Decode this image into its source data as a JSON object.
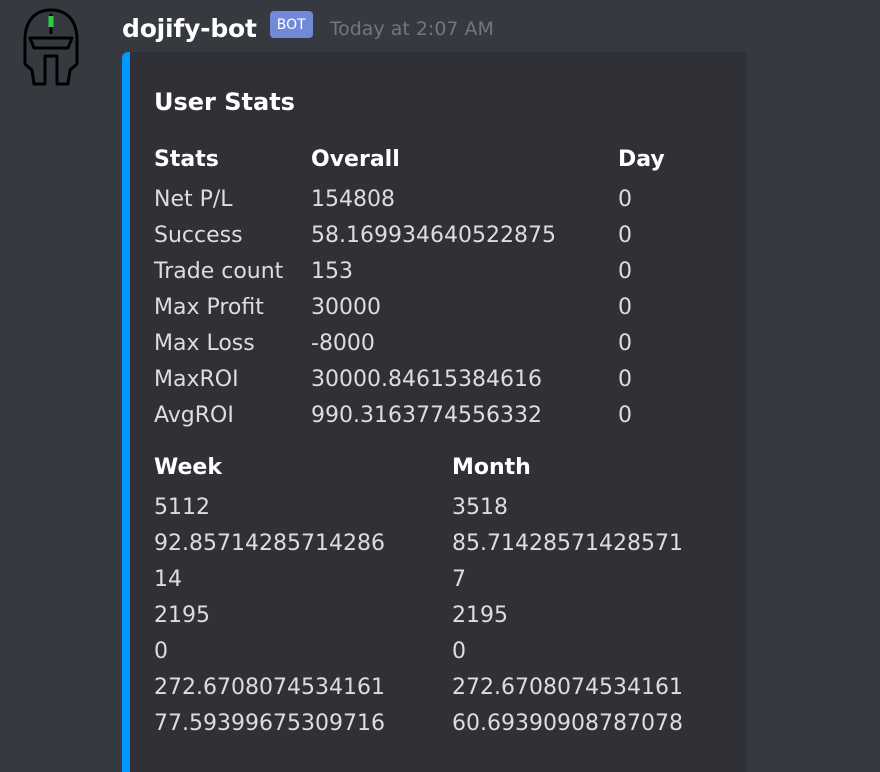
{
  "author": {
    "name": "dojify-bot",
    "tag": "BOT",
    "timestamp": "Today at 2:07 AM",
    "avatar_icon": "spartan-helmet-icon"
  },
  "colors": {
    "background": "#36393f",
    "embed_background": "#2f3136",
    "embed_accent": "#0099ff",
    "bot_tag": "#7289da",
    "timestamp": "#72767d",
    "helmet_eye": "#2ecc40"
  },
  "embed": {
    "title": "User Stats",
    "fields": [
      {
        "name": "Stats",
        "values": [
          "Net P/L",
          "Success",
          "Trade count",
          "Max Profit",
          "Max Loss",
          "MaxROI",
          "AvgROI"
        ]
      },
      {
        "name": "Overall",
        "values": [
          "154808",
          "58.169934640522875",
          "153",
          "30000",
          "-8000",
          "30000.84615384616",
          "990.3163774556332"
        ]
      },
      {
        "name": "Day",
        "values": [
          "0",
          "0",
          "0",
          "0",
          "0",
          "0",
          "0"
        ]
      },
      {
        "name": "Week",
        "values": [
          "5112",
          "92.85714285714286",
          "14",
          "2195",
          "0",
          "272.6708074534161",
          "77.59399675309716"
        ]
      },
      {
        "name": "Month",
        "values": [
          "3518",
          "85.71428571428571",
          "7",
          "2195",
          "0",
          "272.6708074534161",
          "60.69390908787078"
        ]
      }
    ]
  }
}
